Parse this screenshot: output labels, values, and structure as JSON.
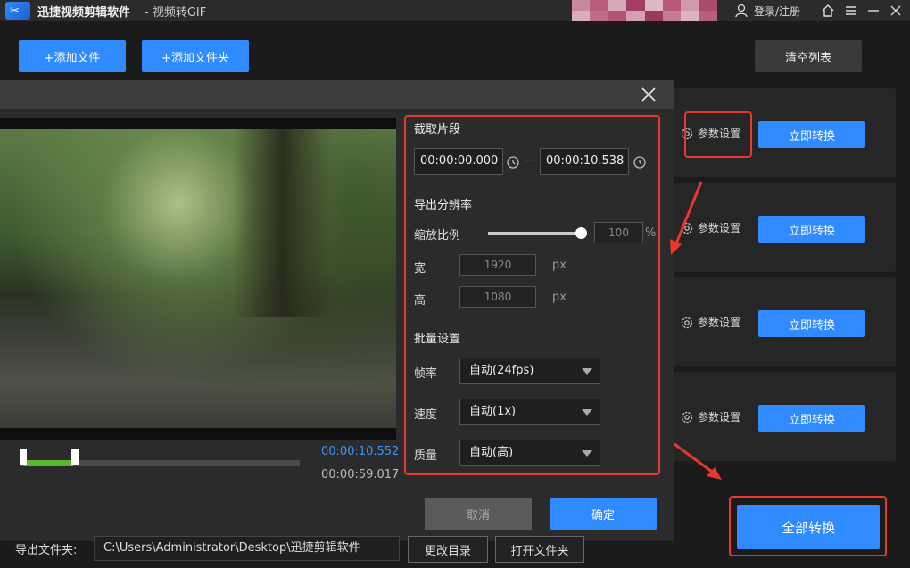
{
  "window": {
    "app_title": "迅捷视频剪辑软件",
    "subtitle": "- 视频转GIF",
    "login": "登录/注册"
  },
  "toolbar": {
    "add_file": "+添加文件",
    "add_folder": "+添加文件夹",
    "clear_list": "清空列表"
  },
  "rows": [
    {
      "param_label": "参数设置",
      "convert_label": "立即转换"
    },
    {
      "param_label": "参数设置",
      "convert_label": "立即转换"
    },
    {
      "param_label": "参数设置",
      "convert_label": "立即转换"
    },
    {
      "param_label": "参数设置",
      "convert_label": "立即转换"
    }
  ],
  "player": {
    "current_time": "00:00:10.552",
    "total_time": "00:00:59.017",
    "selection_fraction": [
      0.013,
      0.19
    ]
  },
  "settings": {
    "clip_title": "截取片段",
    "start_time": "00:00:00.000",
    "separator": "--",
    "end_time": "00:00:10.538",
    "resolution_title": "导出分辨率",
    "scale_label": "缩放比例",
    "scale_value": "100",
    "scale_unit": "%",
    "scale_fraction": 1.0,
    "width_label": "宽",
    "width_value": "1920",
    "height_label": "高",
    "height_value": "1080",
    "px_unit": "px",
    "batch_title": "批量设置",
    "fps_label": "帧率",
    "fps_value": "自动(24fps)",
    "speed_label": "速度",
    "speed_value": "自动(1x)",
    "quality_label": "质量",
    "quality_value": "自动(高)"
  },
  "dialog": {
    "cancel": "取消",
    "ok": "确定"
  },
  "convert_all": "全部转换",
  "footer": {
    "export_label": "导出文件夹:",
    "export_path": "C:\\Users\\Administrator\\Desktop\\迅捷剪辑软件",
    "change_dir": "更改目录",
    "open_folder": "打开文件夹"
  },
  "colors": {
    "accent": "#2f8bff",
    "highlight": "#e8382e",
    "progress": "#55b82e"
  }
}
